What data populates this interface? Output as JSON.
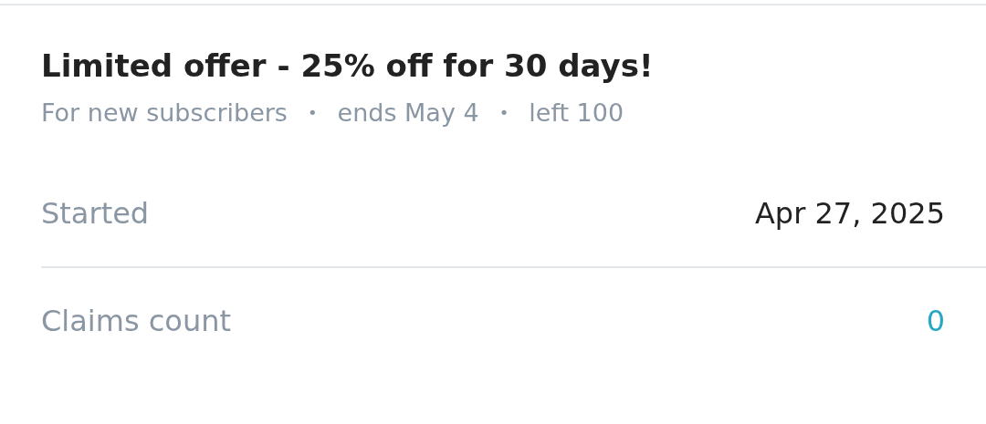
{
  "offer": {
    "title": "Limited offer - 25% off for 30 days!",
    "details": [
      {
        "text": "For new subscribers"
      },
      {
        "text": "ends May 4"
      },
      {
        "text": "left 100"
      }
    ],
    "separator": "•"
  },
  "stats": [
    {
      "label": "Started",
      "value": "Apr 27, 2025",
      "kind": "plain"
    },
    {
      "label": "Claims count",
      "value": "0",
      "kind": "link"
    }
  ]
}
